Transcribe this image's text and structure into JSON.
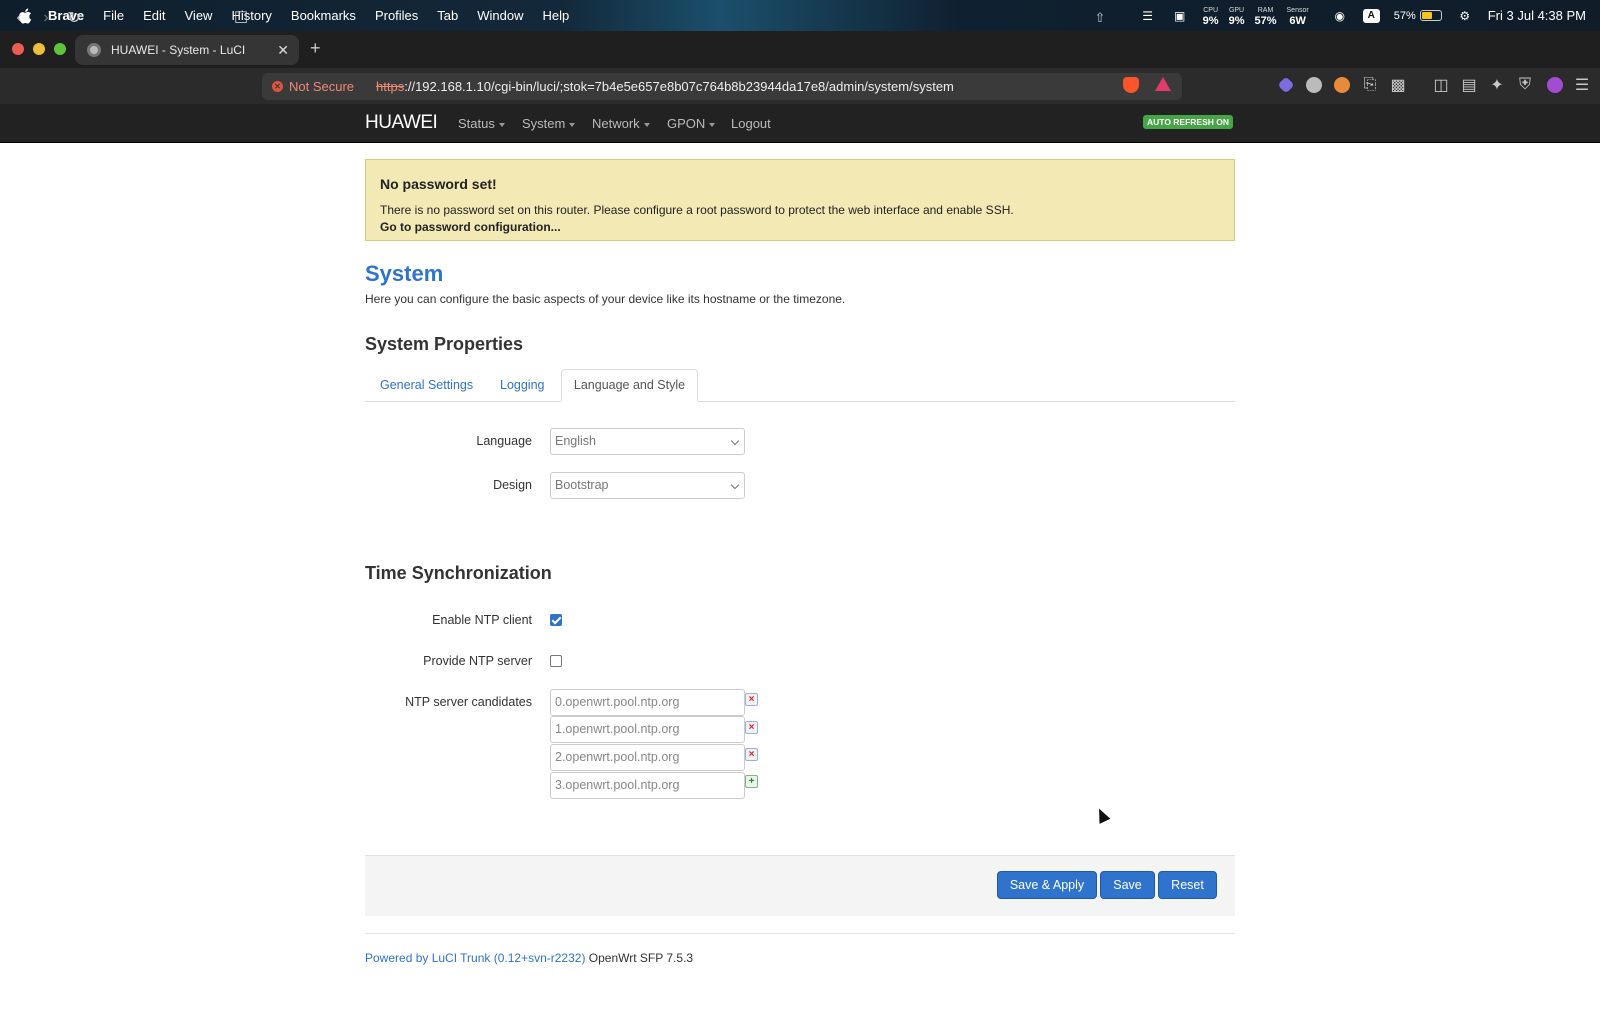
{
  "menubar": {
    "app": "Brave",
    "items": [
      "File",
      "Edit",
      "View",
      "History",
      "Bookmarks",
      "Profiles",
      "Tab",
      "Window",
      "Help"
    ],
    "stats": [
      {
        "label": "CPU",
        "value": "9%"
      },
      {
        "label": "GPU",
        "value": "9%"
      },
      {
        "label": "RAM",
        "value": "57%"
      },
      {
        "label": "Sensor",
        "value": "6W"
      }
    ],
    "battery": "57%",
    "clock": "Fri 3 Jul  4:38 PM"
  },
  "browser": {
    "tab_title": "HUAWEI - System - LuCI",
    "not_secure": "Not Secure",
    "url_scheme": "https",
    "url_rest": "://192.168.1.10/cgi-bin/luci/;stok=7b4e5e657e8b07c764b8b23944da17e8/admin/system/system"
  },
  "luci": {
    "brand": "HUAWEI",
    "nav": [
      "Status",
      "System",
      "Network",
      "GPON"
    ],
    "logout": "Logout",
    "auto_refresh": "AUTO REFRESH ON"
  },
  "alert": {
    "title": "No password set!",
    "message": "There is no password set on this router. Please configure a root password to protect the web interface and enable SSH.",
    "link": "Go to password configuration..."
  },
  "page": {
    "title": "System",
    "description": "Here you can configure the basic aspects of your device like its hostname or the timezone.",
    "section_properties": "System Properties",
    "tabs": [
      "General Settings",
      "Logging",
      "Language and Style"
    ],
    "language_label": "Language",
    "language_value": "English",
    "design_label": "Design",
    "design_value": "Bootstrap",
    "section_time": "Time Synchronization",
    "ntp_client_label": "Enable NTP client",
    "ntp_client_enabled": true,
    "ntp_server_label": "Provide NTP server",
    "ntp_server_enabled": false,
    "ntp_candidates_label": "NTP server candidates",
    "ntp_candidates": [
      "0.openwrt.pool.ntp.org",
      "1.openwrt.pool.ntp.org",
      "2.openwrt.pool.ntp.org",
      "3.openwrt.pool.ntp.org"
    ]
  },
  "actions": {
    "save_apply": "Save & Apply",
    "save": "Save",
    "reset": "Reset"
  },
  "footer": {
    "powered": "Powered by LuCI Trunk (0.12+svn-r2232)",
    "version": "OpenWrt SFP 7.5.3"
  },
  "colors": {
    "accent": "#2f73cc",
    "alert_bg": "#f2e9b5",
    "header_bg": "#222222",
    "refresh_badge": "#46a546"
  }
}
